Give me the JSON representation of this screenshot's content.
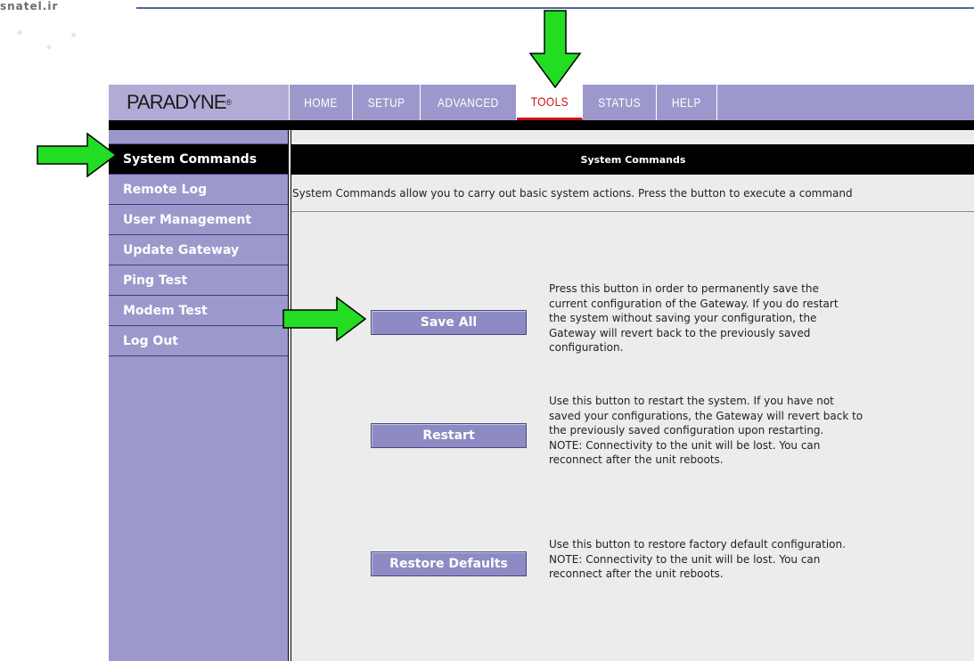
{
  "watermark": "snatel.ir",
  "brand": {
    "name": "PARADYNE",
    "mark": "®"
  },
  "nav": {
    "items": [
      {
        "label": "HOME"
      },
      {
        "label": "SETUP"
      },
      {
        "label": "ADVANCED"
      },
      {
        "label": "TOOLS"
      },
      {
        "label": "STATUS"
      },
      {
        "label": "HELP"
      }
    ],
    "active": "TOOLS"
  },
  "sidebar": {
    "items": [
      {
        "label": "System Commands"
      },
      {
        "label": "Remote Log"
      },
      {
        "label": "User Management"
      },
      {
        "label": "Update Gateway"
      },
      {
        "label": "Ping Test"
      },
      {
        "label": "Modem Test"
      },
      {
        "label": "Log Out"
      }
    ],
    "active": "System Commands"
  },
  "main": {
    "title": "System Commands",
    "intro": "System Commands allow you to carry out basic system actions. Press the button to execute a command",
    "commands": [
      {
        "button": "Save All",
        "lines": [
          "Press this button in order to permanently save the",
          "current configuration of the Gateway. If you do restart",
          "the system without saving your configuration, the",
          "Gateway will revert back to the previously saved",
          "configuration."
        ]
      },
      {
        "button": "Restart",
        "lines": [
          "Use this button to restart the system. If you have not",
          "saved your configurations, the Gateway will revert back to",
          "the previously saved configuration upon restarting.",
          "NOTE: Connectivity to the unit will be lost. You can",
          "reconnect after the unit reboots."
        ]
      },
      {
        "button": "Restore Defaults",
        "lines": [
          "Use this button to restore factory default configuration.",
          "NOTE: Connectivity to the unit will be lost. You can",
          "reconnect after the unit reboots."
        ]
      }
    ]
  },
  "colors": {
    "nav_bg": "#9d98cc",
    "active_tab_text": "#cc1111",
    "button_bg": "#8e8ac4",
    "arrow": "#22dd22"
  },
  "icons": [
    "down-arrow-icon",
    "right-arrow-icon",
    "right-arrow-icon"
  ]
}
